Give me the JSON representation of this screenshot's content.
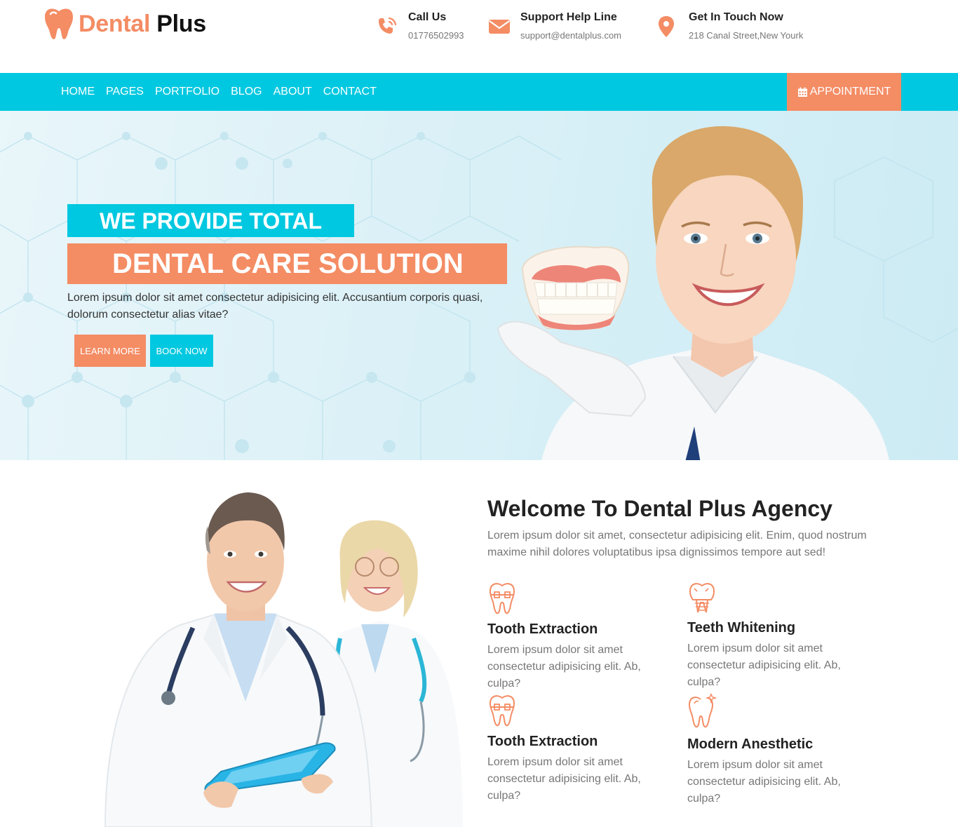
{
  "brand": {
    "name_part1": "Dental",
    "name_part2": "Plus"
  },
  "contacts": [
    {
      "title": "Call Us",
      "value": "01776502993",
      "icon": "phone-ring-icon"
    },
    {
      "title": "Support Help Line",
      "value": "support@dentalplus.com",
      "icon": "envelope-icon"
    },
    {
      "title": "Get In Touch Now",
      "value": "218 Canal Street,New Yourk",
      "icon": "map-pin-icon"
    }
  ],
  "nav": {
    "items": [
      "HOME",
      "PAGES",
      "PORTFOLIO",
      "BLOG",
      "ABOUT",
      "CONTACT"
    ],
    "appointment": "APPOINTMENT"
  },
  "hero": {
    "line1": "WE PROVIDE TOTAL",
    "line2": "DENTAL CARE SOLUTION",
    "text": "Lorem ipsum dolor sit amet consectetur adipisicing elit. Accusantium corporis quasi, dolorum consectetur alias vitae?",
    "learn_more": "LEARN MORE",
    "book_now": "BOOK NOW"
  },
  "welcome": {
    "title": "Welcome To Dental Plus Agency",
    "text": "Lorem ipsum dolor sit amet, consectetur adipisicing elit. Enim, quod nostrum maxime nihil dolores voluptatibus ipsa dignissimos tempore aut sed!",
    "services": [
      {
        "title": "Tooth Extraction",
        "text": "Lorem ipsum dolor sit amet consectetur adipisicing elit. Ab, culpa?",
        "icon": "tooth-braces-icon"
      },
      {
        "title": "Teeth Whitening",
        "text": "Lorem ipsum dolor sit amet consectetur adipisicing elit. Ab, culpa?",
        "icon": "tooth-implant-icon"
      },
      {
        "title": "Tooth Extraction",
        "text": "Lorem ipsum dolor sit amet consectetur adipisicing elit. Ab, culpa?",
        "icon": "tooth-braces-icon"
      },
      {
        "title": "Modern Anesthetic",
        "text": "Lorem ipsum dolor sit amet consectetur adipisicing elit. Ab, culpa?",
        "icon": "tooth-sparkle-icon"
      }
    ]
  },
  "colors": {
    "accent_orange": "#f48c64",
    "accent_cyan": "#00c8e0"
  }
}
